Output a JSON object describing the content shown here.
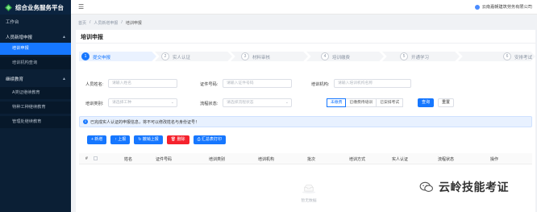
{
  "app": {
    "title": "综合业务服务平台"
  },
  "sidebar": {
    "workbench": "工作台",
    "groups": [
      {
        "label": "人员新增申报",
        "items": [
          {
            "label": "培训申报",
            "active": true
          },
          {
            "label": "培训机构查询",
            "active": false
          }
        ]
      },
      {
        "label": "继续教育",
        "items": [
          {
            "label": "A类证继续教育",
            "active": false
          },
          {
            "label": "特种工种继续教育",
            "active": false
          },
          {
            "label": "管理处继续教育",
            "active": false
          }
        ]
      }
    ]
  },
  "header": {
    "company": "云南嘉朝建筑劳务有限公司"
  },
  "breadcrumb": {
    "items": [
      "首页",
      "人员新增申报",
      "培训申报"
    ]
  },
  "page": {
    "title": "培训申报"
  },
  "steps": [
    {
      "num": "1",
      "label": "提交申报"
    },
    {
      "num": "2",
      "label": "实人认证"
    },
    {
      "num": "3",
      "label": "材料审核"
    },
    {
      "num": "4",
      "label": "培训缴费"
    },
    {
      "num": "5",
      "label": "开通学习"
    },
    {
      "num": "6",
      "label": "安排考试"
    }
  ],
  "filters": {
    "name_label": "人员姓名:",
    "name_placeholder": "请输入姓名",
    "cert_label": "证件号码:",
    "cert_placeholder": "请输入证件号码",
    "org_label": "培训机构:",
    "org_placeholder": "请输入培训机构名称",
    "category_label": "培训类别:",
    "category_placeholder": "请选择工种",
    "status_label": "流程状态:",
    "status_placeholder": "请选择流程状态",
    "segments": [
      {
        "label": "未缴费",
        "on": true
      },
      {
        "label": "已缴费待培训",
        "on": false
      },
      {
        "label": "已安排考试",
        "on": false
      }
    ],
    "query": "查询",
    "reset": "重置"
  },
  "notice": {
    "text": "已完成实人认证的申报信息，将不可以修改姓名与身份证号！"
  },
  "toolbar": {
    "add": "+ 新增",
    "report": "↑ 上报",
    "revoke": "↻ 撤销上报",
    "delete": "删除",
    "print": "汇总表打印"
  },
  "table": {
    "columns": [
      "#",
      "姓名",
      "证件号码",
      "培训类别",
      "培训机构",
      "批次",
      "培训方式",
      "实人认证",
      "流程状态",
      "操作"
    ],
    "rows": []
  },
  "empty": {
    "text": "暂无数据"
  },
  "watermark": {
    "text": "云岭技能考证"
  },
  "colors": {
    "primary": "#1677ff",
    "sidebar": "#0b1f35",
    "danger": "#f5222d"
  }
}
